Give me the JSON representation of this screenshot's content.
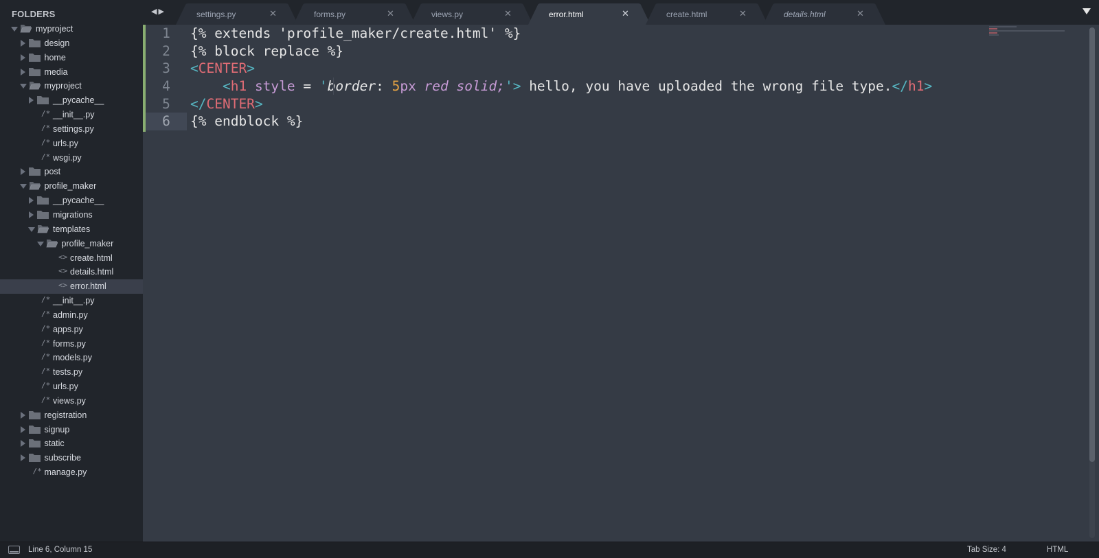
{
  "sidebar": {
    "header": "FOLDERS",
    "tree": [
      {
        "label": "myproject",
        "type": "folder",
        "depth": 0,
        "expanded": true,
        "icon": "folder-open-icon"
      },
      {
        "label": "design",
        "type": "folder",
        "depth": 1,
        "expanded": false,
        "icon": "folder-icon"
      },
      {
        "label": "home",
        "type": "folder",
        "depth": 1,
        "expanded": false,
        "icon": "folder-icon"
      },
      {
        "label": "media",
        "type": "folder",
        "depth": 1,
        "expanded": false,
        "icon": "folder-icon"
      },
      {
        "label": "myproject",
        "type": "folder",
        "depth": 1,
        "expanded": true,
        "icon": "folder-open-icon"
      },
      {
        "label": "__pycache__",
        "type": "folder",
        "depth": 2,
        "expanded": false,
        "icon": "folder-icon"
      },
      {
        "label": "__init__.py",
        "type": "file",
        "depth": 2,
        "icon": "python-file-icon",
        "glyph": "/*"
      },
      {
        "label": "settings.py",
        "type": "file",
        "depth": 2,
        "icon": "python-file-icon",
        "glyph": "/*"
      },
      {
        "label": "urls.py",
        "type": "file",
        "depth": 2,
        "icon": "python-file-icon",
        "glyph": "/*"
      },
      {
        "label": "wsgi.py",
        "type": "file",
        "depth": 2,
        "icon": "python-file-icon",
        "glyph": "/*"
      },
      {
        "label": "post",
        "type": "folder",
        "depth": 1,
        "expanded": false,
        "icon": "folder-icon"
      },
      {
        "label": "profile_maker",
        "type": "folder",
        "depth": 1,
        "expanded": true,
        "icon": "folder-open-icon"
      },
      {
        "label": "__pycache__",
        "type": "folder",
        "depth": 2,
        "expanded": false,
        "icon": "folder-icon"
      },
      {
        "label": "migrations",
        "type": "folder",
        "depth": 2,
        "expanded": false,
        "icon": "folder-icon"
      },
      {
        "label": "templates",
        "type": "folder",
        "depth": 2,
        "expanded": true,
        "icon": "folder-open-icon"
      },
      {
        "label": "profile_maker",
        "type": "folder",
        "depth": 3,
        "expanded": true,
        "icon": "folder-open-icon"
      },
      {
        "label": "create.html",
        "type": "file",
        "depth": 4,
        "icon": "html-file-icon",
        "glyph": "<>"
      },
      {
        "label": "details.html",
        "type": "file",
        "depth": 4,
        "icon": "html-file-icon",
        "glyph": "<>"
      },
      {
        "label": "error.html",
        "type": "file",
        "depth": 4,
        "icon": "html-file-icon",
        "glyph": "<>",
        "selected": true
      },
      {
        "label": "__init__.py",
        "type": "file",
        "depth": 2,
        "icon": "python-file-icon",
        "glyph": "/*"
      },
      {
        "label": "admin.py",
        "type": "file",
        "depth": 2,
        "icon": "python-file-icon",
        "glyph": "/*"
      },
      {
        "label": "apps.py",
        "type": "file",
        "depth": 2,
        "icon": "python-file-icon",
        "glyph": "/*"
      },
      {
        "label": "forms.py",
        "type": "file",
        "depth": 2,
        "icon": "python-file-icon",
        "glyph": "/*"
      },
      {
        "label": "models.py",
        "type": "file",
        "depth": 2,
        "icon": "python-file-icon",
        "glyph": "/*"
      },
      {
        "label": "tests.py",
        "type": "file",
        "depth": 2,
        "icon": "python-file-icon",
        "glyph": "/*"
      },
      {
        "label": "urls.py",
        "type": "file",
        "depth": 2,
        "icon": "python-file-icon",
        "glyph": "/*"
      },
      {
        "label": "views.py",
        "type": "file",
        "depth": 2,
        "icon": "python-file-icon",
        "glyph": "/*"
      },
      {
        "label": "registration",
        "type": "folder",
        "depth": 1,
        "expanded": false,
        "icon": "folder-icon"
      },
      {
        "label": "signup",
        "type": "folder",
        "depth": 1,
        "expanded": false,
        "icon": "folder-icon"
      },
      {
        "label": "static",
        "type": "folder",
        "depth": 1,
        "expanded": false,
        "icon": "folder-icon"
      },
      {
        "label": "subscribe",
        "type": "folder",
        "depth": 1,
        "expanded": false,
        "icon": "folder-icon"
      },
      {
        "label": "manage.py",
        "type": "file",
        "depth": 1,
        "icon": "python-file-icon",
        "glyph": "/*"
      }
    ]
  },
  "tabbar": {
    "nav_back_icon": "triangle-left-icon",
    "nav_forward_icon": "triangle-right-icon",
    "close_glyph": "✕",
    "tabs": [
      {
        "label": "settings.py",
        "active": false,
        "italic": false
      },
      {
        "label": "forms.py",
        "active": false,
        "italic": false
      },
      {
        "label": "views.py",
        "active": false,
        "italic": false
      },
      {
        "label": "error.html",
        "active": true,
        "italic": false
      },
      {
        "label": "create.html",
        "active": false,
        "italic": false
      },
      {
        "label": "details.html",
        "active": false,
        "italic": true
      }
    ],
    "overflow_icon": "triangle-down-icon"
  },
  "editor": {
    "current_line": 6,
    "lines": [
      {
        "number": "1",
        "tokens": [
          {
            "t": "{% extends 'profile_maker/create.html' %}",
            "c": "c-plain"
          }
        ]
      },
      {
        "number": "2",
        "tokens": [
          {
            "t": "{% block replace %}",
            "c": "c-plain"
          }
        ]
      },
      {
        "number": "3",
        "tokens": [
          {
            "t": "<",
            "c": "c-punct"
          },
          {
            "t": "CENTER",
            "c": "c-tag"
          },
          {
            "t": ">",
            "c": "c-punct"
          }
        ]
      },
      {
        "number": "4",
        "tokens": [
          {
            "t": "    ",
            "c": "c-plain"
          },
          {
            "t": "<",
            "c": "c-punct"
          },
          {
            "t": "h1",
            "c": "c-tag"
          },
          {
            "t": " style",
            "c": "c-attr"
          },
          {
            "t": " = ",
            "c": "c-plain"
          },
          {
            "t": "'",
            "c": "c-punct"
          },
          {
            "t": "border",
            "c": "c-italic"
          },
          {
            "t": ": ",
            "c": "c-plain"
          },
          {
            "t": "5",
            "c": "c-num"
          },
          {
            "t": "px",
            "c": "c-attr"
          },
          {
            "t": " red solid",
            "c": "c-kw"
          },
          {
            "t": ";",
            "c": "c-kw"
          },
          {
            "t": "'>",
            "c": "c-punct"
          },
          {
            "t": " hello, you have uploaded the wrong file type.",
            "c": "c-plain"
          },
          {
            "t": "</",
            "c": "c-punct"
          },
          {
            "t": "h1",
            "c": "c-tag"
          },
          {
            "t": ">",
            "c": "c-punct"
          }
        ]
      },
      {
        "number": "5",
        "tokens": [
          {
            "t": "</",
            "c": "c-punct"
          },
          {
            "t": "CENTER",
            "c": "c-tag"
          },
          {
            "t": ">",
            "c": "c-punct"
          }
        ]
      },
      {
        "number": "6",
        "tokens": [
          {
            "t": "{% endblock %}",
            "c": "c-plain"
          }
        ]
      }
    ]
  },
  "statusbar": {
    "panel_icon": "panel-toggle-icon",
    "position": "Line 6, Column 15",
    "tab_size": "Tab Size: 4",
    "syntax": "HTML"
  }
}
